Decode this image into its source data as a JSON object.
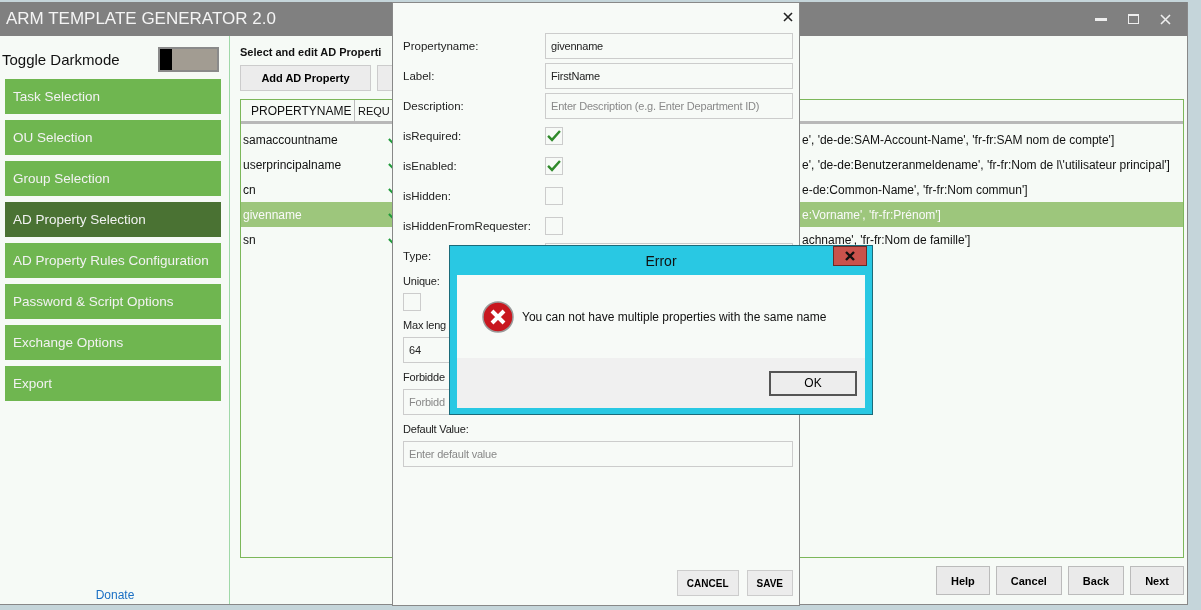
{
  "window": {
    "title": "ARM TEMPLATE GENERATOR 2.0"
  },
  "sidebar": {
    "darkmode": {
      "label": "Toggle Darkmode",
      "on": false
    },
    "items": [
      {
        "label": "Task Selection",
        "selected": false
      },
      {
        "label": "OU Selection",
        "selected": false
      },
      {
        "label": "Group Selection",
        "selected": false
      },
      {
        "label": "AD Property Selection",
        "selected": true
      },
      {
        "label": "AD Property Rules Configuration",
        "selected": false
      },
      {
        "label": "Password & Script Options",
        "selected": false
      },
      {
        "label": "Exchange Options",
        "selected": false
      },
      {
        "label": "Export",
        "selected": false
      }
    ],
    "donate": "Donate"
  },
  "main": {
    "heading": "Select and edit AD Properti",
    "buttons": [
      "Add AD Property"
    ],
    "table": {
      "columns": [
        "PROPERTYNAME",
        "REQU"
      ],
      "rows": [
        {
          "name": "samaccountname",
          "required": true,
          "detail": "e', 'de-de:SAM-Account-Name', 'fr-fr:SAM nom de compte']",
          "selected": false
        },
        {
          "name": "userprincipalname",
          "required": true,
          "detail": "e', 'de-de:Benutzeranmeldename', 'fr-fr:Nom de l\\'utilisateur principal']",
          "selected": false
        },
        {
          "name": "cn",
          "required": true,
          "detail": "e-de:Common-Name', 'fr-fr:Nom commun']",
          "selected": false
        },
        {
          "name": "givenname",
          "required": true,
          "detail": "e:Vorname', 'fr-fr:Prénom']",
          "selected": true
        },
        {
          "name": "sn",
          "required": true,
          "detail": "achname', 'fr-fr:Nom de famille']",
          "selected": false
        }
      ]
    }
  },
  "footer_buttons": [
    "Help",
    "Cancel",
    "Back",
    "Next"
  ],
  "dialog": {
    "fields": [
      {
        "kind": "text",
        "label": "Propertyname:",
        "value": "givenname"
      },
      {
        "kind": "text",
        "label": "Label:",
        "value": "FirstName"
      },
      {
        "kind": "text",
        "label": "Description:",
        "placeholder": "Enter Description (e.g. Enter Department ID)"
      },
      {
        "kind": "check",
        "label": "isRequired:",
        "checked": true
      },
      {
        "kind": "check",
        "label": "isEnabled:",
        "checked": true
      },
      {
        "kind": "check",
        "label": "isHidden:",
        "checked": false
      },
      {
        "kind": "check",
        "label": "isHiddenFromRequester:",
        "checked": false
      },
      {
        "kind": "text",
        "label": "Type:"
      },
      {
        "kind": "stacked-check",
        "label": "Unique:",
        "checked": false
      },
      {
        "kind": "stacked-text",
        "label": "Max leng",
        "value": "64"
      },
      {
        "kind": "stacked-text",
        "label": "Forbidde",
        "placeholder": "Forbidd"
      },
      {
        "kind": "stacked-text",
        "label": "Default Value:",
        "placeholder": "Enter default value"
      }
    ],
    "buttons": [
      "CANCEL",
      "SAVE"
    ]
  },
  "error": {
    "title": "Error",
    "message": "You can not have multiple properties with the same name",
    "button": "OK"
  }
}
